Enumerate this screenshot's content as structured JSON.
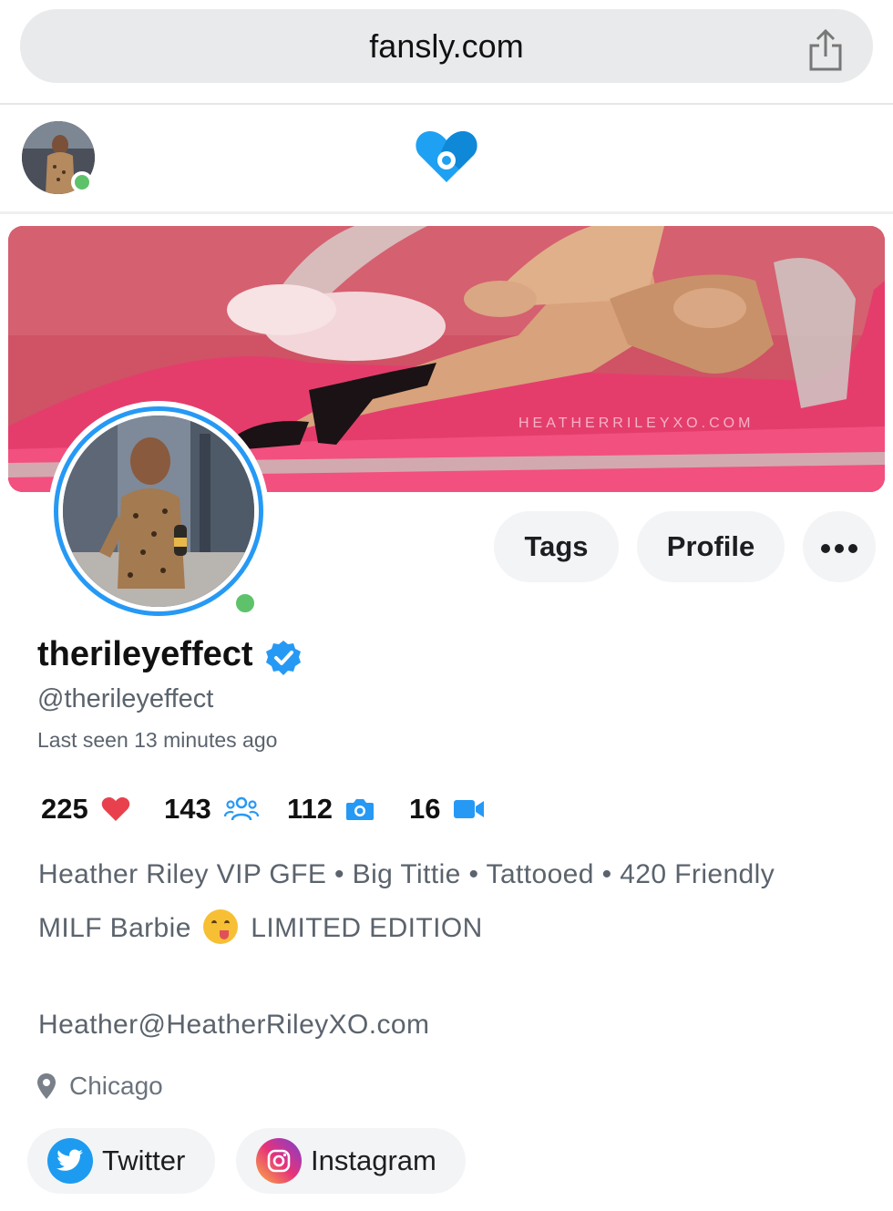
{
  "browser": {
    "url": "fansly.com"
  },
  "banner": {
    "watermark": "HEATHERRILEYXO.COM"
  },
  "actions": {
    "tags_label": "Tags",
    "profile_label": "Profile",
    "more_label": "•••"
  },
  "profile": {
    "display_name": "therileyeffect",
    "handle": "@therileyeffect",
    "last_seen": "Last seen 13 minutes ago",
    "verified": true,
    "online": true
  },
  "stats": {
    "likes": "225",
    "subscribers": "143",
    "photos": "112",
    "videos": "16"
  },
  "bio": {
    "line1": "Heather Riley VIP GFE • Big Tittie • Tattooed • 420 Friendly",
    "line2_before": "MILF Barbie",
    "line2_after": "LIMITED EDITION",
    "emoji": "savoring-food-emoji",
    "email": "Heather@HeatherRileyXO.com"
  },
  "location": "Chicago",
  "social": {
    "twitter_label": "Twitter",
    "instagram_label": "Instagram"
  },
  "colors": {
    "accent": "#2699f5",
    "online": "#5ec26a",
    "heart": "#e8414d",
    "muted_text": "#5b636d",
    "pill_bg": "#f3f4f6"
  }
}
